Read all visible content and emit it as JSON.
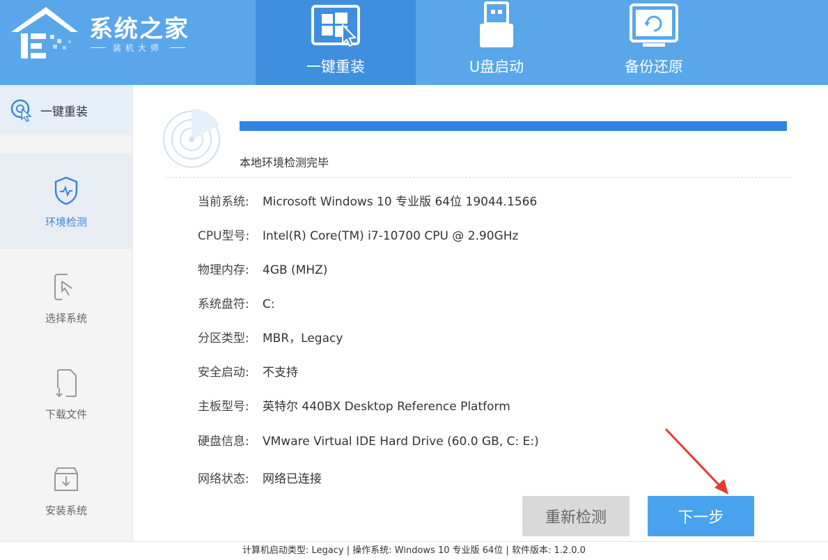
{
  "app": {
    "logo_title": "系统之家",
    "logo_subtitle": "装机大师"
  },
  "top_tabs": [
    {
      "label": "一键重装",
      "icon": "windows-cursor-icon",
      "active": true
    },
    {
      "label": "U盘启动",
      "icon": "usb-drive-icon",
      "active": false
    },
    {
      "label": "备份还原",
      "icon": "backup-restore-icon",
      "active": false
    }
  ],
  "sidebar": {
    "header": {
      "label": "一键重装",
      "icon": "reinstall-icon"
    },
    "steps": [
      {
        "label": "环境检测",
        "icon": "shield-check-icon",
        "active": true
      },
      {
        "label": "选择系统",
        "icon": "select-cursor-icon",
        "active": false
      },
      {
        "label": "下载文件",
        "icon": "download-file-icon",
        "active": false
      },
      {
        "label": "安装系统",
        "icon": "install-box-icon",
        "active": false
      }
    ]
  },
  "detection": {
    "progress_percent": 100,
    "status_text": "本地环境检测完毕"
  },
  "info": [
    {
      "key": "当前系统:",
      "value": "Microsoft Windows 10 专业版 64位 19044.1566"
    },
    {
      "key": "CPU型号:",
      "value": "Intel(R) Core(TM) i7-10700 CPU @ 2.90GHz"
    },
    {
      "key": "物理内存:",
      "value": "4GB (MHZ)"
    },
    {
      "key": "系统盘符:",
      "value": "C:"
    },
    {
      "key": "分区类型:",
      "value": "MBR，Legacy"
    },
    {
      "key": "安全启动:",
      "value": "不支持"
    },
    {
      "key": "主板型号:",
      "value": "英特尔 440BX Desktop Reference Platform"
    },
    {
      "key": "硬盘信息:",
      "value": "VMware Virtual IDE Hard Drive  (60.0 GB, C: E:)"
    },
    {
      "key": "网络状态:",
      "value": "网络已连接"
    }
  ],
  "buttons": {
    "retest": "重新检测",
    "next": "下一步"
  },
  "footer": {
    "text": "计算机启动类型:  Legacy | 操作系统:  Windows 10 专业版 64位 | 软件版本:  1.2.0.0"
  },
  "colors": {
    "topbar": "#5aa6ea",
    "active_tab": "#3f8fde",
    "progress": "#2f84e2",
    "next_button": "#49a2ee",
    "annotation_arrow": "#e53935"
  }
}
